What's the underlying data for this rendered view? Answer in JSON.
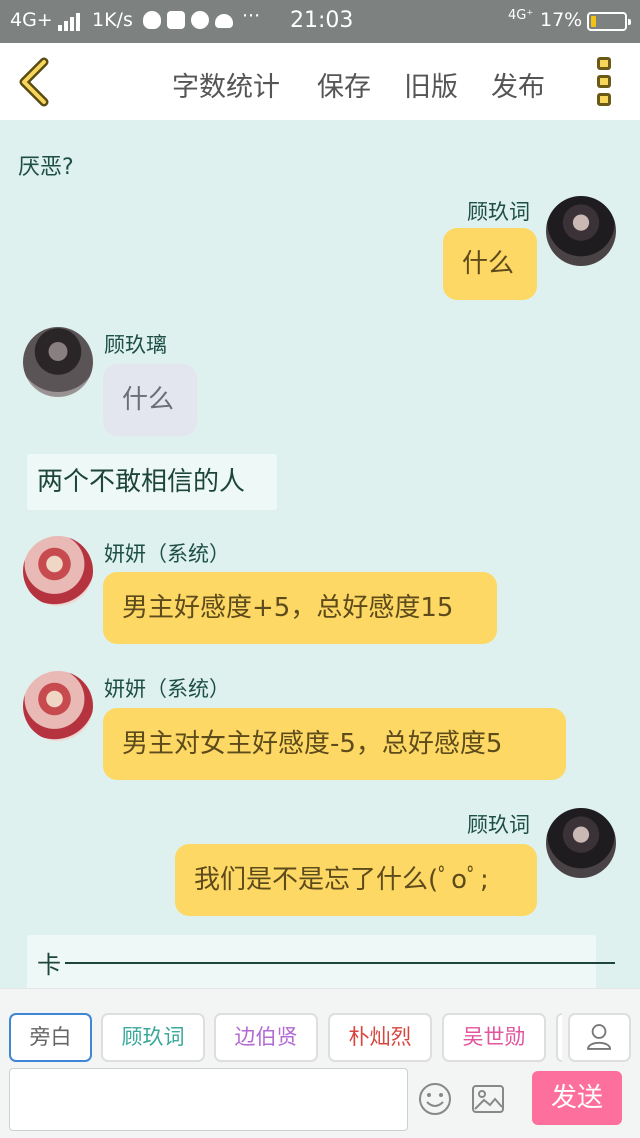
{
  "status_bar": {
    "network": "4G+",
    "speed": "1K/s",
    "time": "21:03",
    "network_right": "4G⁺",
    "battery": "17%",
    "battery_level": 0.17
  },
  "topbar": {
    "word_count_label": "字数统计",
    "save_label": "保存",
    "old_version_label": "旧版",
    "publish_label": "发布"
  },
  "chat": {
    "top_text": "厌恶?",
    "messages": [
      {
        "speaker": "顾玖词",
        "text": "什么"
      },
      {
        "speaker": "顾玖璃",
        "text": "什么"
      },
      {
        "narration": "两个不敢相信的人"
      },
      {
        "speaker": "妍妍（系统）",
        "text": "男主好感度+5，总好感度15"
      },
      {
        "speaker": "妍妍（系统）",
        "text": "男主对女主好感度-5，总好感度5"
      },
      {
        "speaker": "顾玖词",
        "text": "我们是不是忘了什么(ﾟoﾟ;"
      }
    ],
    "last_card_text": "卡"
  },
  "bottom": {
    "characters": [
      "旁白",
      "顾玖词",
      "边伯贤",
      "朴灿烈",
      "吴世勋"
    ],
    "character_colors": [
      "#666666",
      "#3aa89a",
      "#b36ad3",
      "#d7463f",
      "#e2549d"
    ],
    "input_value": "",
    "send_label": "发送"
  },
  "colors": {
    "accent_yellow": "#fdd865",
    "send_pink": "#fd6f9c",
    "chat_background": "#dff1ef"
  }
}
